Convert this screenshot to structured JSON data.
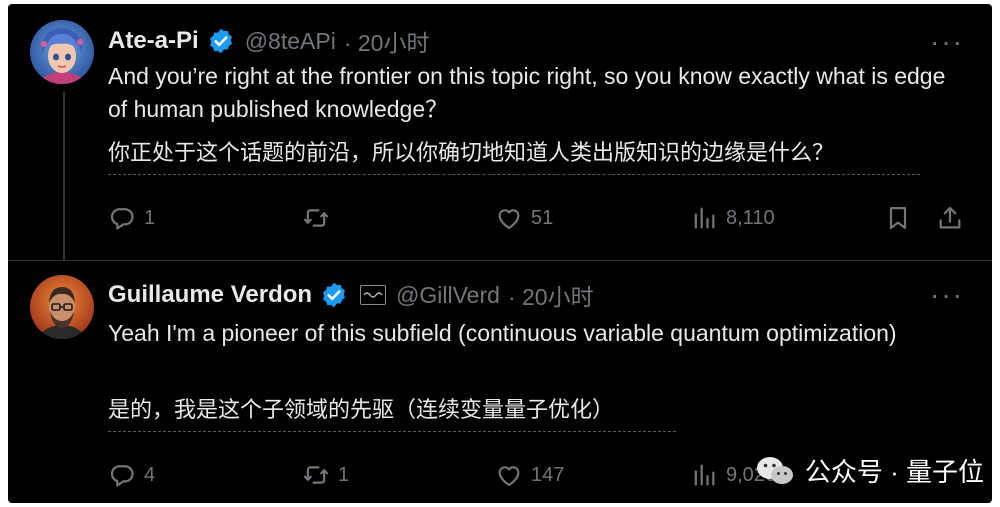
{
  "tweets": [
    {
      "author": "Ate-a-Pi",
      "handle": "@8teAPi",
      "time": "· 20小时",
      "verified": true,
      "text": "And you’re right at the frontier on this topic right, so you know exactly what is edge of human published knowledge？",
      "translation": "你正处于这个话题的前沿，所以你确切地知道人类出版知识的边缘是什么？",
      "actions": {
        "replies": "1",
        "retweets": "",
        "likes": "51",
        "views": "8,110"
      }
    },
    {
      "author": "Guillaume Verdon",
      "handle": "@GillVerd",
      "time": "· 20小时",
      "verified": true,
      "text": "Yeah I'm a pioneer of this subfield (continuous variable quantum optimization)",
      "translation": "是的，我是这个子领域的先驱（连续变量量子优化）",
      "actions": {
        "replies": "4",
        "retweets": "1",
        "likes": "147",
        "views": "9,026"
      }
    }
  ],
  "more_glyph": "···",
  "watermark": {
    "text": "公众号 · 量子位"
  },
  "colors": {
    "background": "#000000",
    "text": "#e7e9ea",
    "muted": "#71767b",
    "verified": "#1d9bf0"
  },
  "icons": [
    "reply-icon",
    "retweet-icon",
    "like-icon",
    "views-icon",
    "bookmark-icon",
    "share-icon",
    "verified-badge-icon",
    "more-icon",
    "wechat-icon"
  ]
}
